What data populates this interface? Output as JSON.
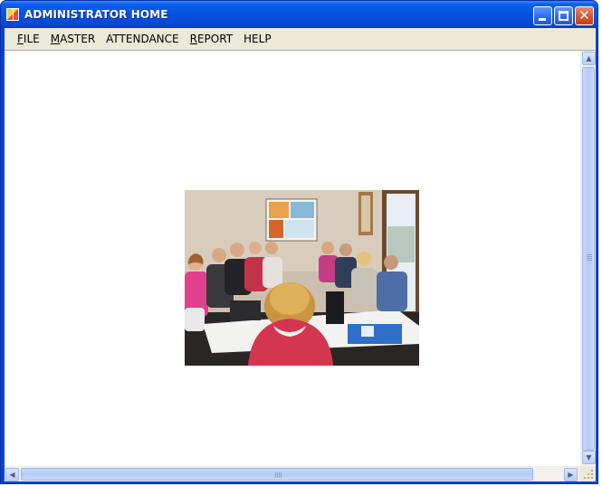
{
  "window": {
    "title": "ADMINISTRATOR HOME"
  },
  "menubar": {
    "items": [
      {
        "underlined": "F",
        "rest": "ILE"
      },
      {
        "underlined": "M",
        "rest": "ASTER"
      },
      {
        "underlined": "",
        "rest": "ATTENDANCE"
      },
      {
        "underlined": "R",
        "rest": "EPORT"
      },
      {
        "underlined": "",
        "rest": "HELP"
      }
    ]
  },
  "content": {
    "image_subject": "classroom photo of students seated around tables facing a wall poster"
  },
  "colors": {
    "titlebar": "#0553e0",
    "client_bg": "#ece9d8",
    "mdi_bg": "#ffffff"
  }
}
